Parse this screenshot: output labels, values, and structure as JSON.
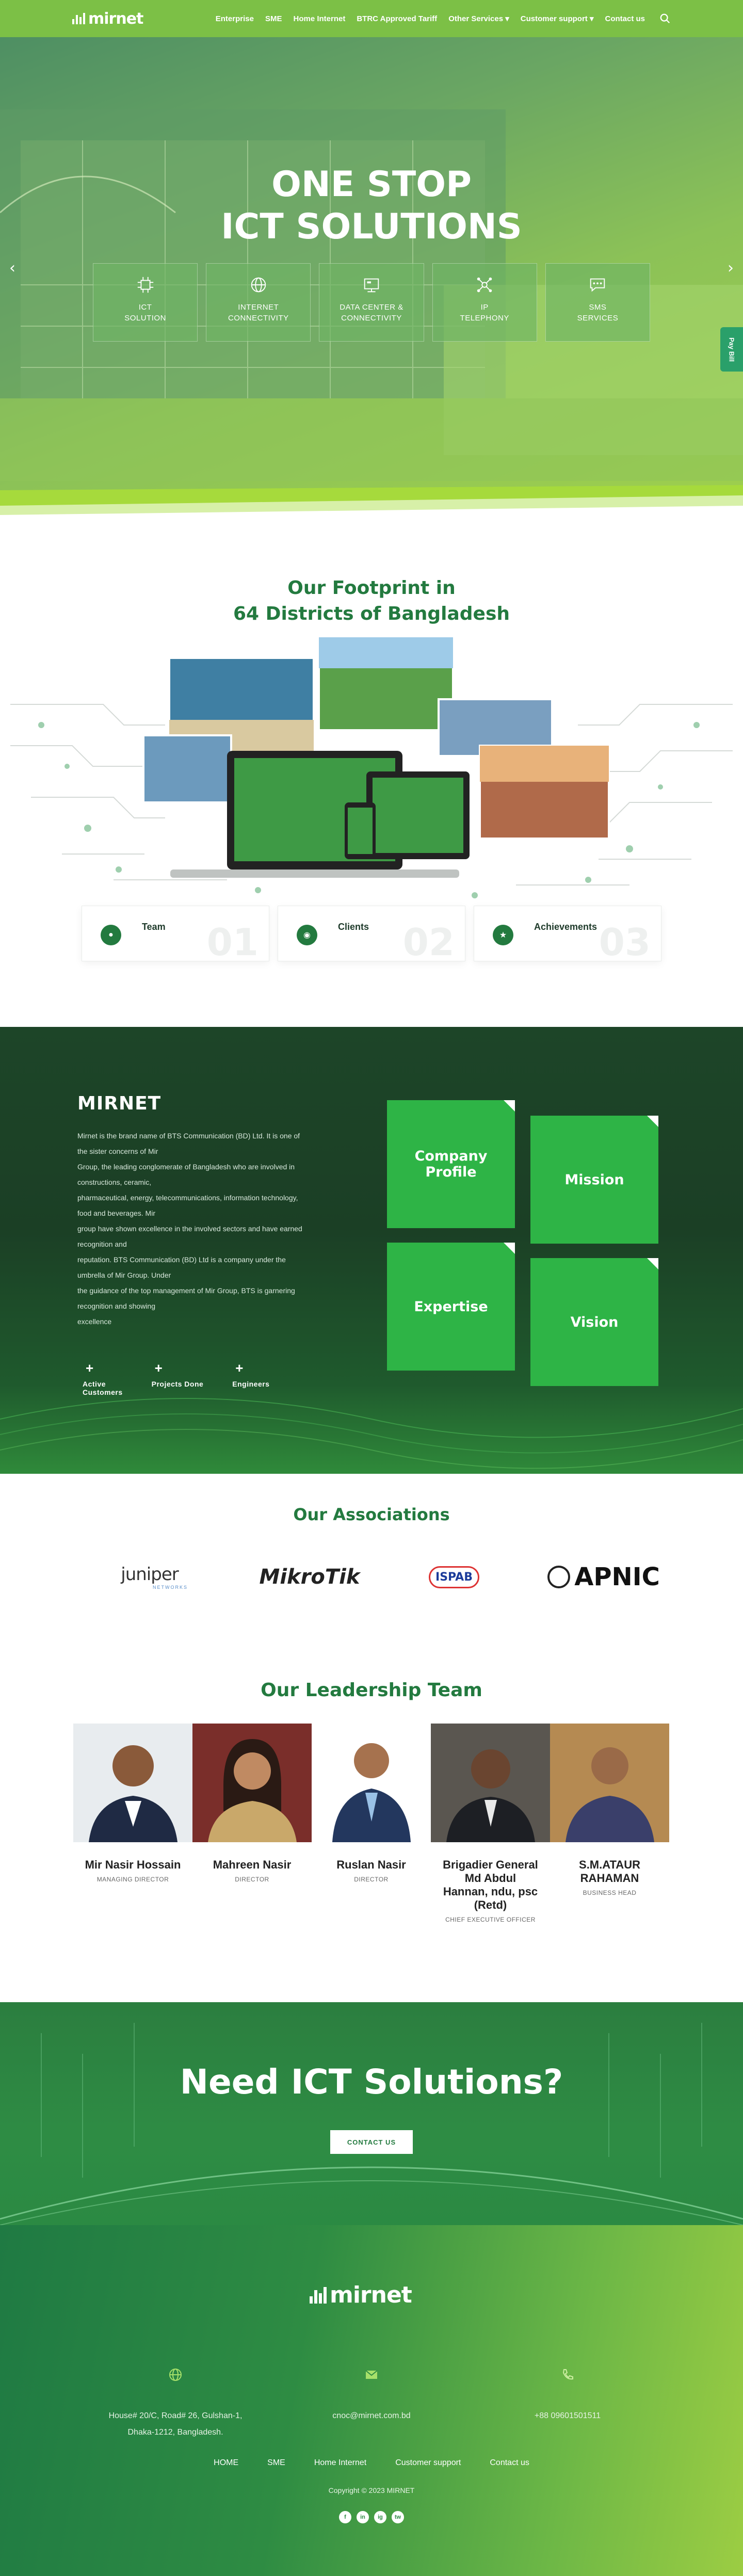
{
  "nav": {
    "logo_text": "mirnet",
    "links": [
      "Enterprise",
      "SME",
      "Home Internet",
      "BTRC Approved Tariff",
      "Other Services ▾",
      "Customer support ▾",
      "Contact us"
    ]
  },
  "hero": {
    "title_line1": "ONE STOP",
    "title_line2": "ICT SOLUTIONS",
    "services": [
      {
        "label": "ICT\nSOLUTION",
        "icon": "chip-icon"
      },
      {
        "label": "INTERNET\nCONNECTIVITY",
        "icon": "globe-icon"
      },
      {
        "label": "DATA CENTER &\nCONNECTIVITY",
        "icon": "server-icon"
      },
      {
        "label": "IP\nTELEPHONY",
        "icon": "network-icon"
      },
      {
        "label": "SMS\nSERVICES",
        "icon": "sms-icon"
      }
    ],
    "pay_bill": "Pay Bill",
    "prev": "‹",
    "next": "›"
  },
  "footprint": {
    "title_line1": "Our Footprint in",
    "title_line2": "64 Districts of Bangladesh",
    "cards": [
      {
        "label": "Team",
        "number": "01"
      },
      {
        "label": "Clients",
        "number": "02"
      },
      {
        "label": "Achievements",
        "number": "03"
      }
    ]
  },
  "about": {
    "title": "MIRNET",
    "text": "Mirnet is the brand name of BTS Communication (BD) Ltd. It is one of\nthe sister concerns of Mir\nGroup, the leading conglomerate of Bangladesh who are involved in\nconstructions, ceramic,\npharmaceutical, energy, telecommunications, information technology,\nfood and beverages. Mir\ngroup have shown excellence in the involved sectors and have earned\nrecognition and\nreputation. BTS Communication (BD) Ltd is a company under the\numbrella of Mir Group. Under\nthe guidance of the top management of Mir Group, BTS is garnering\nrecognition and showing\nexcellence",
    "stats": [
      "Active\nCustomers",
      "Projects Done",
      "Engineers"
    ],
    "tiles": [
      "Company Profile",
      "Mission",
      "Expertise",
      "Vision"
    ]
  },
  "associations": {
    "title": "Our Associations",
    "logos": [
      "JUNIPER",
      "MikroTik",
      "ISPAB",
      "APNIC"
    ],
    "juniper_sub": "NETWORKS"
  },
  "leadership": {
    "title": "Our Leadership Team",
    "members": [
      {
        "name": "Mir Nasir Hossain",
        "role": "MANAGING DIRECTOR"
      },
      {
        "name": "Mahreen Nasir",
        "role": "DIRECTOR"
      },
      {
        "name": "Ruslan Nasir",
        "role": "DIRECTOR"
      },
      {
        "name": "Brigadier General\nMd Abdul\nHannan, ndu, psc\n(Retd)",
        "role": "CHIEF EXECUTIVE OFFICER"
      },
      {
        "name": "S.M.ATAUR\nRAHAMAN",
        "role": "BUSINESS HEAD"
      }
    ]
  },
  "cta": {
    "title": "Need ICT Solutions?",
    "button": "CONTACT US"
  },
  "footer": {
    "logo_text": "mirnet",
    "address": "House# 20/C, Road# 26, Gulshan-1,\nDhaka-1212, Bangladesh.",
    "email": "cnoc@mirnet.com.bd",
    "phone": "+88 09601501511",
    "links": [
      "HOME",
      "SME",
      "Home Internet",
      "Customer support",
      "Contact us"
    ],
    "copyright": "Copyright © 2023 MIRNET",
    "socials": [
      "f",
      "in",
      "ig",
      "tw"
    ]
  },
  "colors": {
    "brand_green": "#237a3f",
    "nav_green": "#7cc046",
    "tile_green": "#2eb446"
  }
}
